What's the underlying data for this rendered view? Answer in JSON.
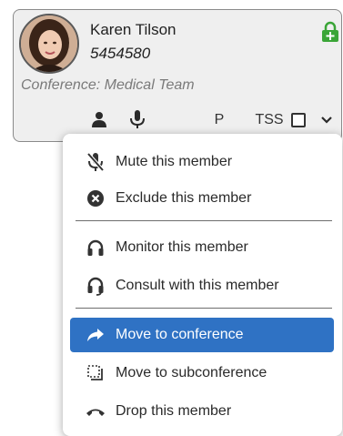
{
  "participant": {
    "name": "Karen Tilson",
    "number": "5454580",
    "conference_label": "Conference: Medical Team"
  },
  "toolbar": {
    "p_label": "P",
    "tss_label": "TSS",
    "tss_checked": false
  },
  "menu": {
    "items": [
      {
        "label": "Mute this member",
        "icon": "mic-off-icon"
      },
      {
        "label": "Exclude this member",
        "icon": "close-circle-icon"
      },
      {
        "label": "Monitor this member",
        "icon": "headphones-icon"
      },
      {
        "label": "Consult with this member",
        "icon": "headset-icon"
      },
      {
        "label": "Move to conference",
        "icon": "share-arrow-icon",
        "selected": true
      },
      {
        "label": "Move to subconference",
        "icon": "subconference-icon"
      },
      {
        "label": "Drop this member",
        "icon": "hangup-icon"
      }
    ]
  },
  "colors": {
    "selected_bg": "#2f72c4",
    "lock_green": "#3aa537",
    "card_bg": "#efefef"
  }
}
